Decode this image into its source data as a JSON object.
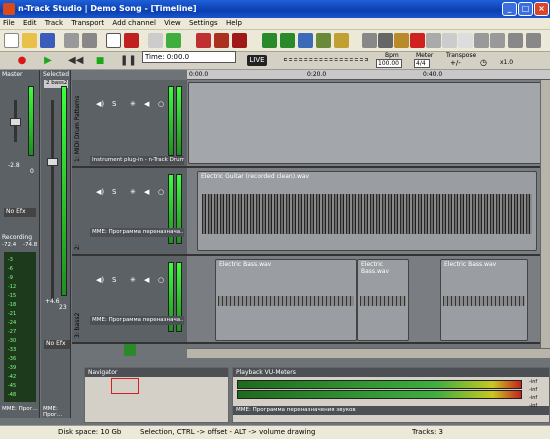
{
  "window": {
    "title": "n-Track Studio | Demo Song - [Timeline]",
    "minimize": "_",
    "maximize": "□",
    "close": "×"
  },
  "menu": [
    "File",
    "Edit",
    "Track",
    "Transport",
    "Add channel",
    "View",
    "Settings",
    "Help"
  ],
  "toolbar": {
    "bpm_label": "Bpm",
    "bpm_value": "100.00",
    "meter_label": "Meter",
    "meter_value": "4/4",
    "transpose_label": "Transpose",
    "transpose_value": "+/-",
    "zoom_value": "x1.0",
    "time_label": "Time: 0:00.0",
    "live_label": "LIVE"
  },
  "panels": {
    "master_label": "Master",
    "selected_label": "Selected",
    "selected_channel": "2 bass2",
    "master_volume": "-2.8",
    "master_pan": "0",
    "no_efx": "No Efx",
    "recording_label": "Recording",
    "recording_levels": [
      "-72.4",
      "-74.8"
    ],
    "selected_volume": "+4.6",
    "selected_pan": "23",
    "selected_efx": "No Efx",
    "selected_device": "MME: Прог...",
    "db_scale": [
      "-3",
      "-6",
      "-9",
      "-12",
      "-15",
      "-18",
      "-21",
      "-24",
      "-27",
      "-30",
      "-33",
      "-36",
      "-39",
      "-42",
      "-45",
      "-48",
      "-51"
    ]
  },
  "ruler": [
    "0:00.0",
    "0:20.0",
    "0:40.0",
    "0:00.0",
    "0:20.0",
    "0:40.0"
  ],
  "tracks": [
    {
      "name": "1: MIDI Drum Patterns",
      "device": "Instrument plug-in - n-Track Drums",
      "mute": "S"
    },
    {
      "name": "2: ",
      "device": "MME: Программа переназнача...",
      "mute": "S"
    },
    {
      "name": "3: bass2",
      "device": "MME: Программа переназнача...",
      "mute": "S"
    }
  ],
  "clips": {
    "guitar": "Electric Guitar (recorded clean).wav",
    "bass": [
      "Electric Bass.wav",
      "Electric Bass.wav",
      "Electric Bass.wav"
    ]
  },
  "bottom": {
    "navigator_label": "Navigator",
    "playback_vu_label": "Playback VU-Meters",
    "playback_device": "MME: Программа переназначения звуков",
    "vu_scale": [
      "-inf",
      "-inf",
      "-inf",
      "-inf"
    ],
    "master_device": "MME: Прог..."
  },
  "status": {
    "disk": "Disk space: 10 Gb",
    "hint": "Selection, CTRL -> offset - ALT -> volume drawing",
    "tracks": "Tracks: 3"
  },
  "colors": {
    "title_bar": "#0a3fb0",
    "vu_green": "#3cff3c",
    "clip_gray": "#9a9ea2",
    "record_red": "#d81818",
    "play_green": "#18a818"
  }
}
